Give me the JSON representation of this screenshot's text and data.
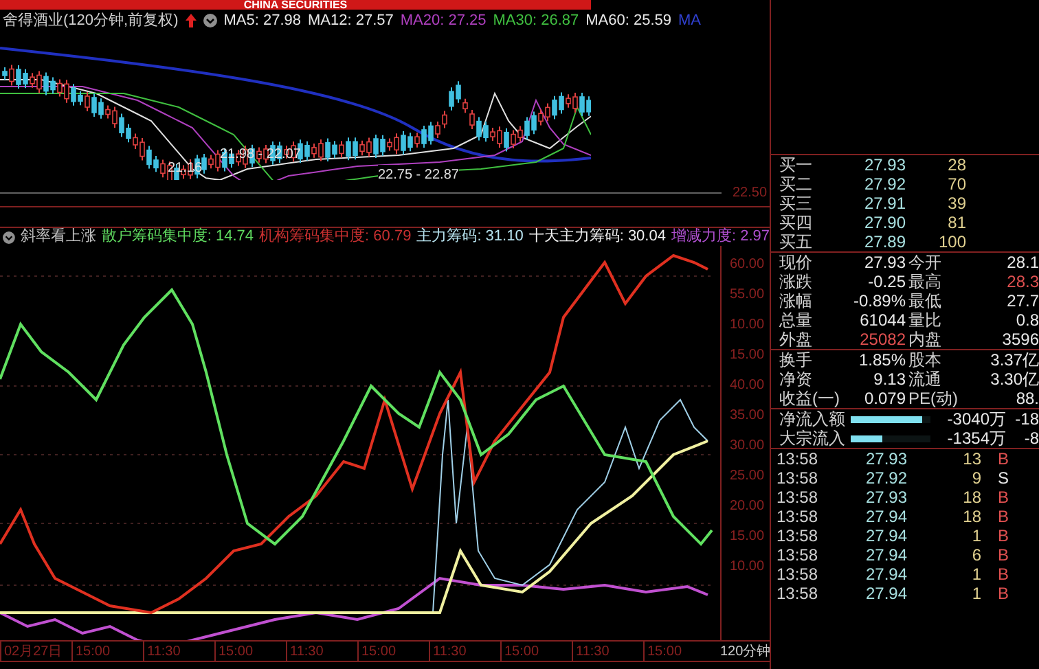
{
  "header": {
    "logo": "CHINA SECURITIES",
    "title": "舍得酒业(120分钟,前复权)",
    "ma": [
      {
        "label": "MA5: 27.98",
        "color": "#e8e8e8"
      },
      {
        "label": "MA12: 27.57",
        "color": "#e8e8e8"
      },
      {
        "label": "MA20: 27.25",
        "color": "#b040c0"
      },
      {
        "label": "MA30: 26.87",
        "color": "#40c040"
      },
      {
        "label": "MA60: 25.59",
        "color": "#e8e8e8"
      },
      {
        "label": "MA",
        "color": "#3040d0"
      }
    ]
  },
  "price_chart": {
    "axis_label": "22.50",
    "annotations": [
      "21.16",
      "21.98 - 22.07",
      "22.75 - 22.87"
    ]
  },
  "indicator": {
    "name": "斜率看上涨",
    "legend": [
      {
        "label": "散户筹码集中度: 14.74",
        "color": "#60dc60"
      },
      {
        "label": "机构筹码集中度: 60.79",
        "color": "#c83030"
      },
      {
        "label": "主力筹码: 31.10",
        "color": "#b8e4f0"
      },
      {
        "label": "十天主力筹码: 30.04",
        "color": "#f0f0f0"
      },
      {
        "label": "增减力度: 2.97",
        "color": "#b050d0"
      }
    ],
    "axis_labels": [
      "60.00",
      "55.00",
      "10.00",
      "15.00",
      "40.00",
      "35.00",
      "30.00",
      "25.00",
      "20.00",
      "15.00",
      "10.00"
    ]
  },
  "time_axis": [
    "02月27日",
    "15:00",
    "11:30",
    "15:00",
    "11:30",
    "15:00",
    "11:30",
    "15:00",
    "11:30",
    "15:00"
  ],
  "period": "120分钟",
  "quote": {
    "bids": [
      {
        "label": "买一",
        "price": "27.93",
        "volume": "28"
      },
      {
        "label": "买二",
        "price": "27.92",
        "volume": "70"
      },
      {
        "label": "买三",
        "price": "27.91",
        "volume": "39"
      },
      {
        "label": "买四",
        "price": "27.90",
        "volume": "81"
      },
      {
        "label": "买五",
        "price": "27.89",
        "volume": "100"
      }
    ],
    "stats": [
      {
        "label": "现价",
        "value": "27.93",
        "up": false,
        "label2": "今开",
        "value2": "28.1",
        "up2": false
      },
      {
        "label": "涨跌",
        "value": "-0.25",
        "up": false,
        "label2": "最高",
        "value2": "28.3",
        "up2": true
      },
      {
        "label": "涨幅",
        "value": "-0.89%",
        "up": false,
        "label2": "最低",
        "value2": "27.7",
        "up2": false
      },
      {
        "label": "总量",
        "value": "61044",
        "up": false,
        "label2": "量比",
        "value2": "0.8",
        "up2": false
      },
      {
        "label": "外盘",
        "value": "25082",
        "up": true,
        "label2": "内盘",
        "value2": "3596",
        "up2": false
      }
    ],
    "stats2": [
      {
        "label": "换手",
        "value": "1.85%",
        "label2": "股本",
        "value2": "3.37亿"
      },
      {
        "label": "净资",
        "value": "9.13",
        "label2": "流通",
        "value2": "3.30亿"
      },
      {
        "label": "收益(一)",
        "value": "0.079",
        "label2": "PE(动)",
        "value2": "88."
      }
    ],
    "flows": [
      {
        "label": "净流入额",
        "level": 0.9,
        "value": "-3040万",
        "value2": "-18"
      },
      {
        "label": "大宗流入",
        "level": 0.4,
        "value": "-1354万",
        "value2": "-8"
      }
    ],
    "trades": [
      {
        "time": "13:58",
        "price": "27.93",
        "volume": "13",
        "side": "B"
      },
      {
        "time": "13:58",
        "price": "27.92",
        "volume": "9",
        "side": "S"
      },
      {
        "time": "13:58",
        "price": "27.93",
        "volume": "18",
        "side": "B"
      },
      {
        "time": "13:58",
        "price": "27.94",
        "volume": "18",
        "side": "B"
      },
      {
        "time": "13:58",
        "price": "27.94",
        "volume": "1",
        "side": "B"
      },
      {
        "time": "13:58",
        "price": "27.94",
        "volume": "6",
        "side": "B"
      },
      {
        "time": "13:58",
        "price": "27.94",
        "volume": "1",
        "side": "B"
      },
      {
        "time": "13:58",
        "price": "27.94",
        "volume": "1",
        "side": "B"
      }
    ]
  }
}
